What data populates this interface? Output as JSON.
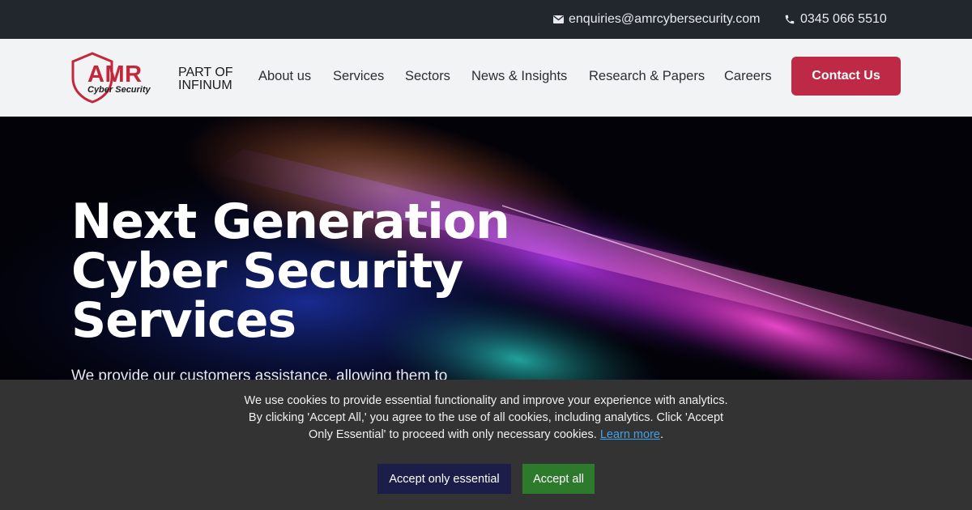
{
  "topbar": {
    "email": "enquiries@amrcybersecurity.com",
    "phone": "0345 066 5510"
  },
  "logo": {
    "brand": "AMR",
    "tagline": "Cyber Security",
    "part_of_line1": "PART OF",
    "part_of_line2": "INFINUM"
  },
  "nav": {
    "items": [
      {
        "label": "About us"
      },
      {
        "label": "Services"
      },
      {
        "label": "Sectors"
      },
      {
        "label": "News & Insights"
      },
      {
        "label": "Research & Papers"
      },
      {
        "label": "Careers"
      }
    ],
    "cta": "Contact Us"
  },
  "hero": {
    "title_line1": "Next Generation",
    "title_line2": "Cyber Security",
    "title_line3": "Services",
    "subtitle": "We provide our customers assistance, allowing them to"
  },
  "cookie_banner": {
    "text": "We use cookies to provide essential functionality and improve your experience with analytics. By clicking 'Accept All,' you agree to the use of all cookies, including analytics. Click 'Accept Only Essential' to proceed with only necessary cookies.",
    "link": "Learn more",
    "accept_essential": "Accept only essential",
    "accept_all": "Accept all"
  },
  "colors": {
    "brand_red": "#be2a45",
    "topbar_bg": "#22272e",
    "navbar_bg": "#f2f3f5",
    "cookie_bg": "#333333",
    "btn_essential_bg": "#1d1d4a",
    "btn_all_bg": "#2d7a2d"
  },
  "icons": {
    "email": "envelope-icon",
    "phone": "phone-icon"
  }
}
